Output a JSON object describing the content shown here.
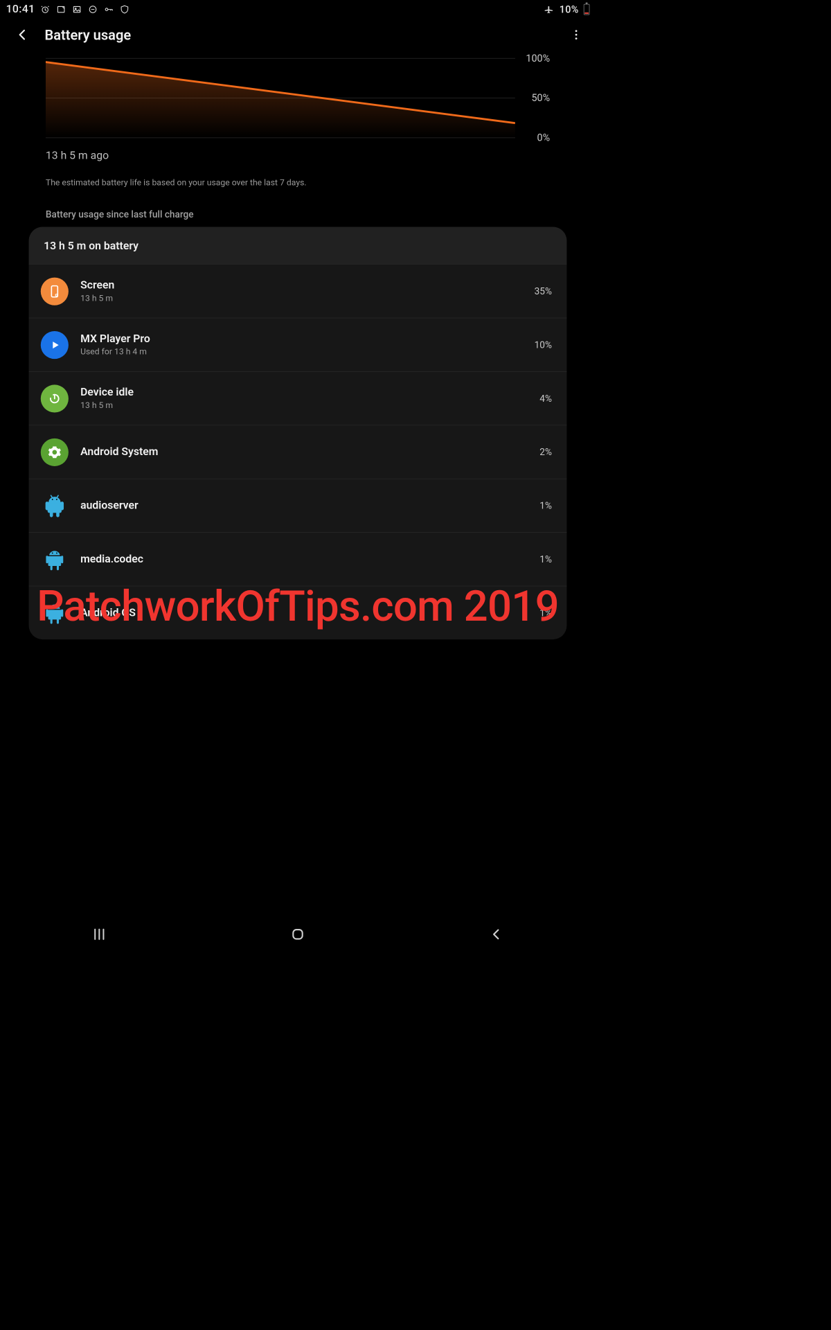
{
  "status": {
    "time": "10:41",
    "battery_text": "10%"
  },
  "header": {
    "title": "Battery usage"
  },
  "chart_data": {
    "type": "line",
    "x": [
      0,
      100
    ],
    "values": [
      95,
      18
    ],
    "ylabels": [
      "100%",
      "50%",
      "0%"
    ],
    "ylim": [
      0,
      100
    ],
    "xlabel_left": "13 h 5 m ago",
    "title": "",
    "xlabel": "",
    "ylabel": ""
  },
  "chart": {
    "time_ago": "13 h 5 m ago",
    "note": "The estimated battery life is based on your usage over the last 7 days.",
    "section_label": "Battery usage since last full charge"
  },
  "card": {
    "header": "13 h 5 m on battery",
    "items": [
      {
        "name": "Screen",
        "sub": "13 h 5 m",
        "pct": "35%"
      },
      {
        "name": "MX Player Pro",
        "sub": "Used for 13 h 4 m",
        "pct": "10%"
      },
      {
        "name": "Device idle",
        "sub": "13 h 5 m",
        "pct": "4%"
      },
      {
        "name": "Android System",
        "sub": "",
        "pct": "2%"
      },
      {
        "name": "audioserver",
        "sub": "",
        "pct": "1%"
      },
      {
        "name": "media.codec",
        "sub": "",
        "pct": "1%"
      },
      {
        "name": "Android OS",
        "sub": "",
        "pct": "1%"
      }
    ]
  },
  "watermark": "PatchworkOfTips.com 2019"
}
